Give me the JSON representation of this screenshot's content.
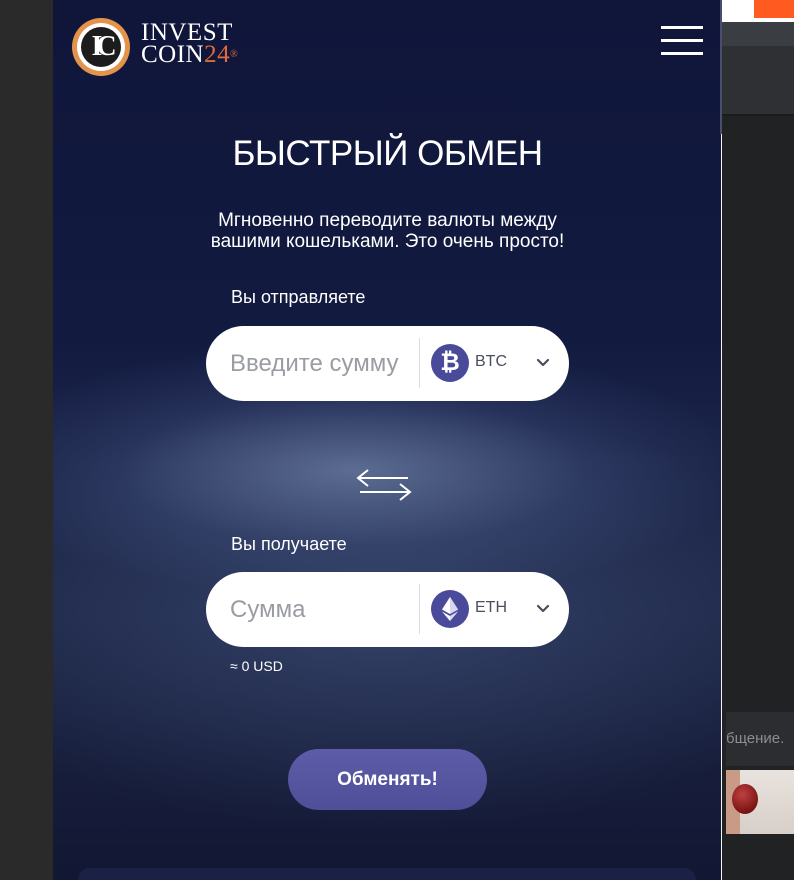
{
  "brand": {
    "line1": "INVEST",
    "line2": "COIN",
    "line2_num": "24",
    "reg_mark": "®",
    "logo_letters": "IC"
  },
  "menu_icon": "hamburger-icon",
  "exchange": {
    "title": "БЫСТРЫЙ ОБМЕН",
    "subtitle": "Мгновенно переводите валюты между вашими кошельками. Это очень просто!",
    "send": {
      "label": "Вы отправляете",
      "placeholder": "Введите сумму",
      "currency": "BTC",
      "currency_icon": "bitcoin-icon",
      "currency_symbol": "₿"
    },
    "swap_icon": "swap-arrows-icon",
    "receive": {
      "label": "Вы получаете",
      "placeholder": "Сумма",
      "currency": "ETH",
      "currency_icon": "ethereum-icon",
      "usd_estimate": "≈ 0 USD"
    },
    "submit_label": "Обменять!"
  },
  "background_page": {
    "snippet_text": "бщение."
  },
  "colors": {
    "panel_bg": "#10163a",
    "button": "#5453a0",
    "coin_bg": "#4a4a9a",
    "logo_orange": "#e3944a",
    "accent_orange": "#ff5a1f"
  }
}
